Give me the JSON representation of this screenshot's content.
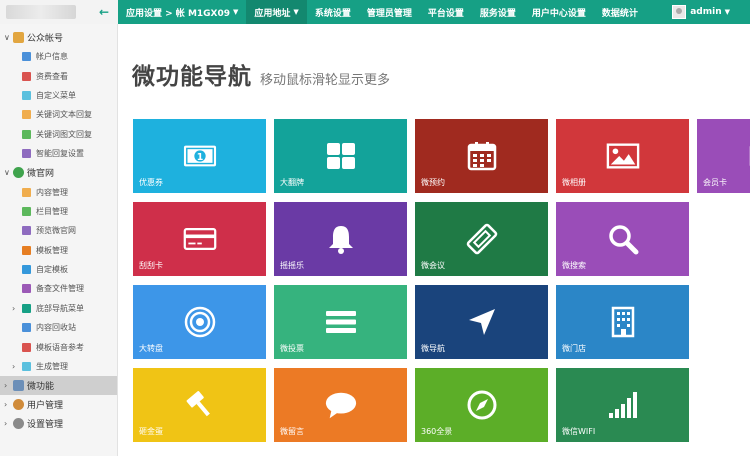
{
  "topbar": {
    "nav": [
      {
        "label": "应用设置 > 帐 M1GX09",
        "caret": true,
        "active": false
      },
      {
        "label": "应用地址",
        "caret": true,
        "active": true
      },
      {
        "label": "系统设置",
        "caret": false,
        "active": false
      },
      {
        "label": "管理员管理",
        "caret": false,
        "active": false
      },
      {
        "label": "平台设置",
        "caret": false,
        "active": false
      },
      {
        "label": "服务设置",
        "caret": false,
        "active": false
      },
      {
        "label": "用户中心设置",
        "caret": false,
        "active": false
      },
      {
        "label": "数据统计",
        "caret": false,
        "active": false
      }
    ],
    "user": {
      "name": "admin"
    }
  },
  "sidebar": {
    "group1": {
      "label": "公众帐号",
      "toggle": "∨"
    },
    "group1_items": [
      "帐户信息",
      "资费查看",
      "自定义菜单",
      "关键词文本回复",
      "关键词图文回复",
      "智能回复设置"
    ],
    "group2": {
      "label": "微官网",
      "toggle": "∨"
    },
    "group2_items": [
      {
        "label": "内容管理",
        "toggle": ""
      },
      {
        "label": "栏目管理",
        "toggle": ""
      },
      {
        "label": "预览微官网",
        "toggle": ""
      },
      {
        "label": "模板管理",
        "toggle": ""
      },
      {
        "label": "自定模板",
        "toggle": ""
      },
      {
        "label": "备查文件管理",
        "toggle": ""
      },
      {
        "label": "底部导航菜单",
        "toggle": "›"
      },
      {
        "label": "内容回收站",
        "toggle": ""
      },
      {
        "label": "模板语音参考",
        "toggle": ""
      },
      {
        "label": "生成管理",
        "toggle": "›"
      }
    ],
    "group3": {
      "label": "微功能",
      "toggle": "›"
    },
    "group4": {
      "label": "用户管理",
      "toggle": "›"
    },
    "group5": {
      "label": "设置管理",
      "toggle": "›"
    }
  },
  "main": {
    "title": "微功能导航",
    "subtitle": "移动鼠标滑轮显示更多"
  },
  "tiles": [
    {
      "label": "优惠券",
      "color": "#1eb1de",
      "icon": "money-icon"
    },
    {
      "label": "大翻牌",
      "color": "#13a39a",
      "icon": "grid-icon"
    },
    {
      "label": "微预约",
      "color": "#a02a1f",
      "icon": "calendar-icon"
    },
    {
      "label": "微相册",
      "color": "#d1373b",
      "icon": "picture-icon"
    },
    {
      "label": "会员卡",
      "color": "#9a4db8",
      "icon": "card-icon"
    },
    {
      "label": "刮刮卡",
      "color": "#cf2f4a",
      "icon": "creditcard-icon"
    },
    {
      "label": "摇摇乐",
      "color": "#6a3aa5",
      "icon": "bell-icon"
    },
    {
      "label": "微会议",
      "color": "#1f7a45",
      "icon": "ticket-icon"
    },
    {
      "label": "微搜索",
      "color": "#9a4db8",
      "icon": "search-icon"
    },
    {
      "label": "大转盘",
      "color": "#3d96e8",
      "icon": "target-icon"
    },
    {
      "label": "微投票",
      "color": "#36b37e",
      "icon": "list-icon"
    },
    {
      "label": "微导航",
      "color": "#1a447c",
      "icon": "location-arrow-icon"
    },
    {
      "label": "微门店",
      "color": "#2b86c7",
      "icon": "building-icon"
    },
    {
      "label": "砸金蛋",
      "color": "#f0c415",
      "icon": "hammer-icon"
    },
    {
      "label": "微留言",
      "color": "#ec7a25",
      "icon": "comment-icon"
    },
    {
      "label": "360全景",
      "color": "#5cae28",
      "icon": "compass-icon"
    },
    {
      "label": "微信WIFI",
      "color": "#2a8a52",
      "icon": "signal-icon"
    }
  ]
}
